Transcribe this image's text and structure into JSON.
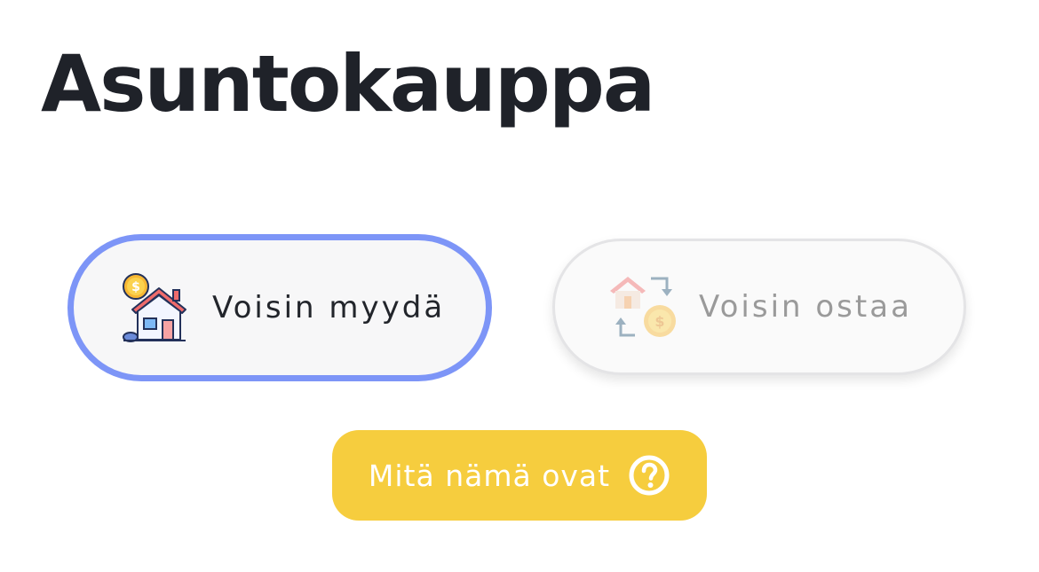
{
  "page": {
    "title": "Asuntokauppa"
  },
  "options": {
    "sell": {
      "label": "Voisin myydä",
      "icon": "house-for-sale-icon",
      "state": "selected"
    },
    "buy": {
      "label": "Voisin ostaa",
      "icon": "house-exchange-icon",
      "state": "unselected"
    }
  },
  "info_button": {
    "label": "Mitä nämä ovat",
    "icon": "question-circle-icon"
  },
  "colors": {
    "selected_border": "#7d95f7",
    "info_button_bg": "#f6cd3e",
    "title_text": "#1f2229"
  }
}
